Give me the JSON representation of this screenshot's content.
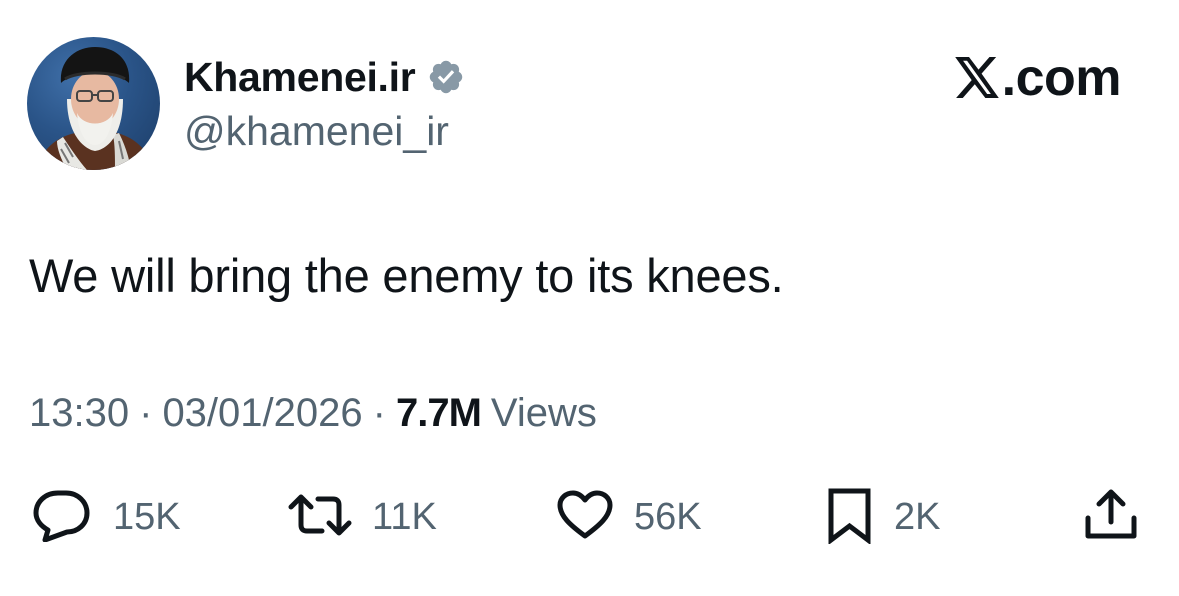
{
  "author": {
    "display_name": "Khamenei.ir",
    "handle": "@khamenei_ir",
    "verified": true,
    "avatar_icon": "profile-photo"
  },
  "brand": {
    "text": ".com",
    "logo_icon": "x-logo-icon"
  },
  "tweet": {
    "text": "We will bring the enemy to its knees."
  },
  "meta": {
    "time": "13:30",
    "separator": "·",
    "date": "03/01/2026",
    "views_count": "7.7M",
    "views_label": "Views"
  },
  "actions": {
    "replies": "15K",
    "reposts": "11K",
    "likes": "56K",
    "bookmarks": "2K"
  },
  "colors": {
    "primary_text": "#0f1419",
    "secondary_text": "#536471",
    "verified_badge": "#8899a6"
  }
}
